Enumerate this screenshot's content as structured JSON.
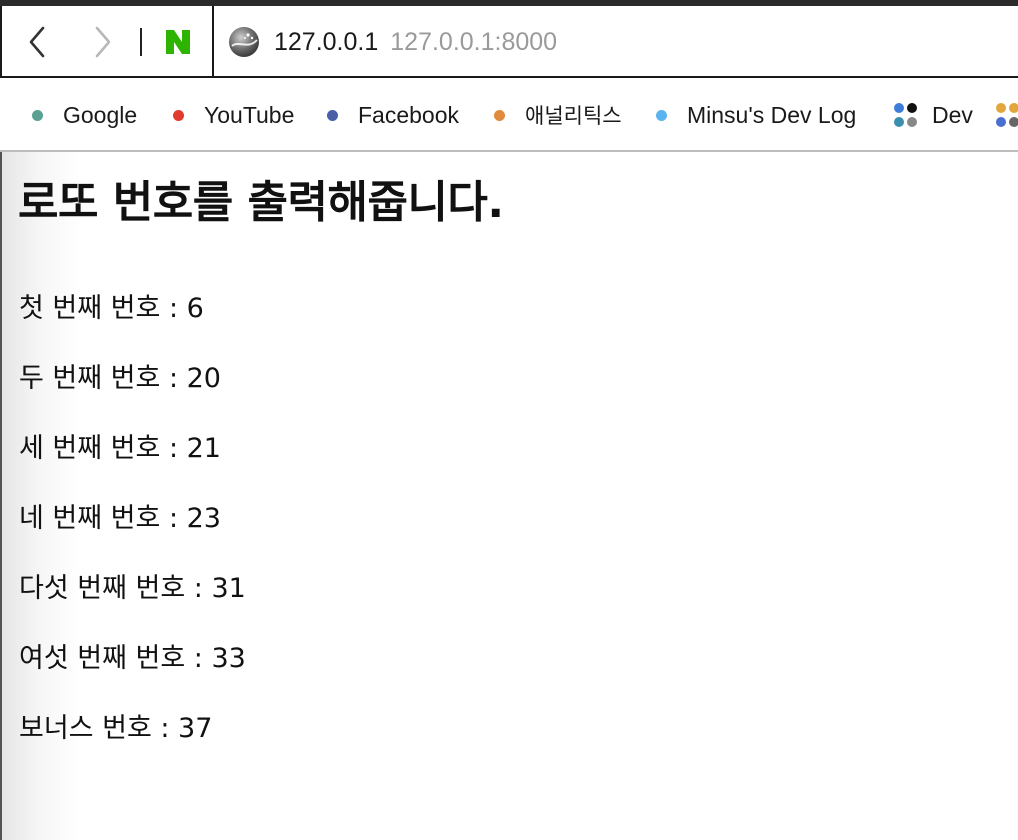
{
  "browser": {
    "address_host": "127.0.0.1",
    "address_full": "127.0.0.1:8000",
    "nav": {
      "back_icon": "chevron-left-icon",
      "forward_icon": "chevron-right-icon",
      "home_icon": "naver-n-icon",
      "home_letter": "N",
      "home_color": "#2db400"
    },
    "bookmarks": [
      {
        "label": "Google",
        "dot_color": "#5aa093"
      },
      {
        "label": "YouTube",
        "dot_color": "#e23a2e"
      },
      {
        "label": "Facebook",
        "dot_color": "#4a5fa8"
      },
      {
        "label": "애널리틱스",
        "dot_color": "#e08a3c"
      },
      {
        "label": "Minsu's Dev Log",
        "dot_color": "#5ab4ef"
      },
      {
        "label": "Dev",
        "icon": "folder-grid-icon"
      }
    ]
  },
  "page": {
    "title": "로또 번호를 출력해줍니다.",
    "lines": [
      "첫 번째 번호 : 6",
      "두 번째 번호 : 20",
      "세 번째 번호 : 21",
      "네 번째 번호 : 23",
      "다섯 번째 번호 : 31",
      "여섯 번째 번호 : 33",
      "보너스 번호 : 37"
    ]
  }
}
